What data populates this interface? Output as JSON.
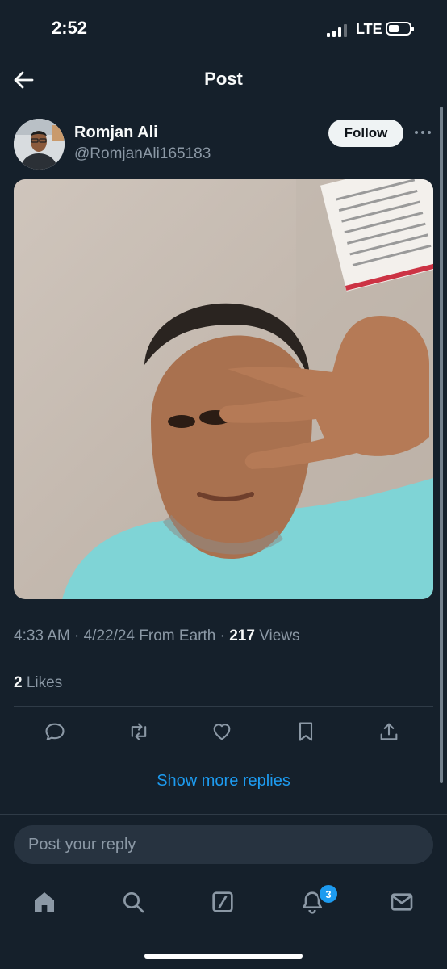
{
  "status_bar": {
    "time": "2:52",
    "network": "LTE"
  },
  "header": {
    "title": "Post",
    "back_icon": "arrow-left-icon"
  },
  "author": {
    "display_name": "Romjan Ali",
    "handle": "@RomjanAli165183",
    "follow_label": "Follow",
    "more_icon": "ellipsis-icon"
  },
  "post": {
    "time": "4:33 AM",
    "date": "4/22/24",
    "source": "From Earth",
    "views_count": "217",
    "views_label": "Views",
    "likes_count": "2",
    "likes_label": "Likes"
  },
  "actions": [
    "reply-icon",
    "retweet-icon",
    "like-icon",
    "bookmark-icon",
    "share-icon"
  ],
  "show_more_label": "Show more replies",
  "reply_box": {
    "placeholder": "Post your reply"
  },
  "bottom_nav": {
    "items": [
      "home-icon",
      "search-icon",
      "grok-icon",
      "notifications-icon",
      "messages-icon"
    ],
    "notifications_badge": "3"
  },
  "colors": {
    "background": "#15202b",
    "accent": "#1d9bf0",
    "secondary_text": "#8b98a5"
  }
}
